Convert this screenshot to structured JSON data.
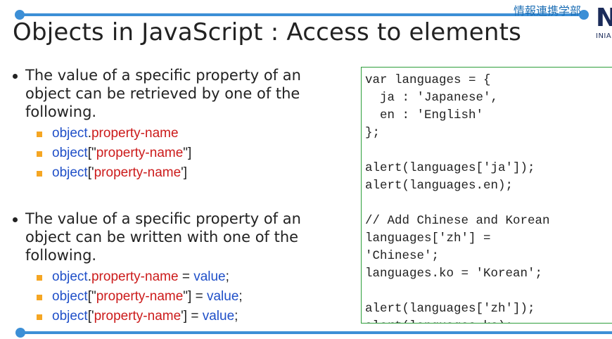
{
  "header": {
    "dept": "情報連携学部",
    "logo_letter": "N",
    "logo_sub": "INIAD",
    "title": "Objects in JavaScript : Access to elements"
  },
  "bullets": [
    {
      "text": "The value of a specific property of an object can be retrieved by one of the following.",
      "items": [
        [
          {
            "t": "object",
            "c": "b"
          },
          {
            "t": ".",
            "c": "k"
          },
          {
            "t": "property-name",
            "c": "r"
          }
        ],
        [
          {
            "t": "object",
            "c": "b"
          },
          {
            "t": "[\"",
            "c": "k"
          },
          {
            "t": "property-name",
            "c": "r"
          },
          {
            "t": "\"]",
            "c": "k"
          }
        ],
        [
          {
            "t": "object",
            "c": "b"
          },
          {
            "t": "['",
            "c": "k"
          },
          {
            "t": "property-name",
            "c": "r"
          },
          {
            "t": "']",
            "c": "k"
          }
        ]
      ]
    },
    {
      "text": "The value of a specific property of an object can be written with one of the following.",
      "items": [
        [
          {
            "t": "object",
            "c": "b"
          },
          {
            "t": ".",
            "c": "k"
          },
          {
            "t": "property-name",
            "c": "r"
          },
          {
            "t": " = ",
            "c": "k"
          },
          {
            "t": "value",
            "c": "b"
          },
          {
            "t": ";",
            "c": "k"
          }
        ],
        [
          {
            "t": "object",
            "c": "b"
          },
          {
            "t": "[\"",
            "c": "k"
          },
          {
            "t": "property-name",
            "c": "r"
          },
          {
            "t": "\"] = ",
            "c": "k"
          },
          {
            "t": "value",
            "c": "b"
          },
          {
            "t": ";",
            "c": "k"
          }
        ],
        [
          {
            "t": "object",
            "c": "b"
          },
          {
            "t": "['",
            "c": "k"
          },
          {
            "t": "property-name",
            "c": "r"
          },
          {
            "t": "'] = ",
            "c": "k"
          },
          {
            "t": "value",
            "c": "b"
          },
          {
            "t": ";",
            "c": "k"
          }
        ]
      ]
    }
  ],
  "code": "var languages = {\n  ja : 'Japanese',\n  en : 'English'\n};\n\nalert(languages['ja']);\nalert(languages.en);\n\n// Add Chinese and Korean\nlanguages['zh'] =\n'Chinese';\nlanguages.ko = 'Korean';\n\nalert(languages['zh']);\nalert(languages.ko);",
  "colors": {
    "accent": "#3c8fd6",
    "code_border": "#2e9e3b",
    "bullet_square": "#f5a623",
    "blue": "#1f4fc8",
    "red": "#cc1b1b"
  }
}
